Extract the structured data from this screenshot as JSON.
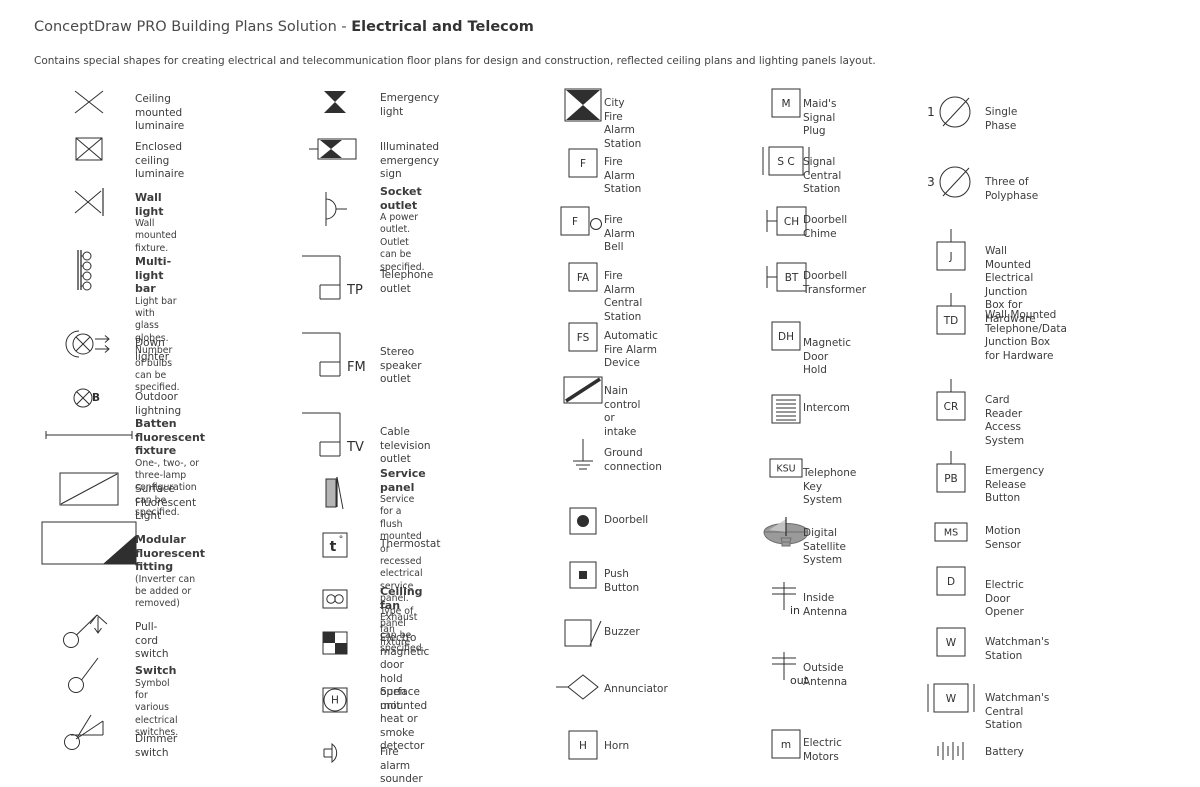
{
  "header": {
    "title_normal": "ConceptDraw PRO Building Plans Solution - ",
    "title_bold": "Electrical and Telecom",
    "subtitle": "Contains special shapes for creating electrical and telecommunication floor plans for design and construction, reflected ceiling plans and lighting panels layout."
  },
  "colors": {
    "ink": "#2f2f2f",
    "text": "#3c3c3c",
    "satellite_body": "#9a9a9a",
    "satellite_light": "#c9c9c9",
    "panel_fill": "#b5b5b5"
  },
  "columns": [
    {
      "id": "col-1",
      "items": [
        {
          "id": "ceiling-mounted-luminaire",
          "icon": "x-cross",
          "title": "Ceiling mounted luminaire",
          "desc": []
        },
        {
          "id": "enclosed-ceiling-luminaire",
          "icon": "boxed-x",
          "title": "Enclosed ceiling luminaire",
          "desc": []
        },
        {
          "id": "wall-light",
          "icon": "wall-x",
          "title": "Wall light",
          "desc": [
            "Wall mounted fixture."
          ]
        },
        {
          "id": "multi-light-bar",
          "icon": "multi-light-bar",
          "title": "Multi-light bar",
          "desc": [
            "Light bar with glass globes.",
            "Number of bulbs can be specified."
          ]
        },
        {
          "id": "down-lighter",
          "icon": "down-lighter",
          "title": "Down lighter",
          "desc": []
        },
        {
          "id": "outdoor-lightning",
          "icon": "circle-x-b",
          "badge": "B",
          "title": "Outdoor lightning",
          "desc": []
        },
        {
          "id": "batten-fluorescent-fixture",
          "icon": "batten-bar",
          "title": "Batten fluorescent fixture",
          "desc": [
            "One-, two-, or three-lamp",
            "configuration can be specified."
          ]
        },
        {
          "id": "surface-fluorescent-light",
          "icon": "rect-diag",
          "title": "Surface Fluorescent Light",
          "desc": []
        },
        {
          "id": "modular-fluorescent-fitting",
          "icon": "rect-inverter",
          "title": "Modular fluorescent fitting",
          "desc": [
            "(Inverter can be added or",
            "removed)"
          ]
        },
        {
          "id": "pull-cord-switch",
          "icon": "pull-cord-switch",
          "title": "Pull-cord switch",
          "desc": []
        },
        {
          "id": "switch",
          "icon": "switch",
          "title": "Switch",
          "desc": [
            "Symbol for various electrical",
            "switches."
          ]
        },
        {
          "id": "dimmer-switch",
          "icon": "dimmer-switch",
          "title": "Dimmer switch",
          "desc": []
        }
      ]
    },
    {
      "id": "col-2",
      "items": [
        {
          "id": "emergency-light",
          "icon": "bowtie",
          "title": "Emergency light",
          "desc": []
        },
        {
          "id": "illuminated-emergency-sign",
          "icon": "bowtie-sign",
          "title": "Illuminated emergency sign",
          "desc": []
        },
        {
          "id": "socket-outlet",
          "icon": "socket-outlet",
          "title": "Socket outlet",
          "desc": [
            "A power outlet. Outlet can be",
            "specified."
          ]
        },
        {
          "id": "telephone-outlet",
          "icon": "outlet-drop",
          "badge": "TP",
          "title": "Telephone outlet",
          "desc": []
        },
        {
          "id": "stereo-speaker-outlet",
          "icon": "outlet-drop",
          "badge": "FM",
          "title": "Stereo speaker outlet",
          "desc": []
        },
        {
          "id": "cable-television-outlet",
          "icon": "outlet-drop",
          "badge": "TV",
          "title": "Cable television outlet",
          "desc": []
        },
        {
          "id": "service-panel",
          "icon": "service-panel",
          "title": "Service panel",
          "desc": [
            "Service for a flush mounted or recessed",
            " electrical service panel. Type of panel",
            "can be specified."
          ]
        },
        {
          "id": "thermostat",
          "icon": "thermostat",
          "badge": "t°",
          "title": "Thermostat",
          "desc": []
        },
        {
          "id": "ceiling-fan",
          "icon": "ceiling-fan",
          "title": "Ceiling fan",
          "desc": [
            "Exhaust fan fixture"
          ]
        },
        {
          "id": "electro-magnetic-door-hold",
          "icon": "checker",
          "title": "Electro magnetic door hold open",
          "desc": [
            "unit"
          ],
          "title_two_line": true
        },
        {
          "id": "heat-smoke-detector",
          "icon": "boxed-circle-h",
          "badge": "H",
          "title": "Surface mounted heat or smoke",
          "desc": [
            "detector"
          ],
          "title_two_line": true
        },
        {
          "id": "fire-alarm-sounder",
          "icon": "fire-alarm-sounder",
          "title": "Fire alarm sounder",
          "desc": []
        }
      ]
    },
    {
      "id": "col-3",
      "items": [
        {
          "id": "city-fire-alarm-station",
          "icon": "boxed-bowtie-filled",
          "title": "City Fire Alarm Station",
          "desc": []
        },
        {
          "id": "fire-alarm-station",
          "icon": "box-label",
          "badge": "F",
          "title": "Fire Alarm Station",
          "desc": []
        },
        {
          "id": "fire-alarm-bell",
          "icon": "box-label-bell",
          "badge": "F",
          "title": "Fire Alarm Bell",
          "desc": []
        },
        {
          "id": "fire-alarm-central-station",
          "icon": "box-label",
          "badge": "FA",
          "title": "Fire Alarm Central Station",
          "desc": []
        },
        {
          "id": "automatic-fire-alarm-device",
          "icon": "box-label",
          "badge": "FS",
          "title": "Automatic Fire Alarm Device",
          "desc": []
        },
        {
          "id": "main-control-or-intake",
          "icon": "rect-thick-diag",
          "title": "Nain control or intake",
          "desc": []
        },
        {
          "id": "ground-connection",
          "icon": "ground",
          "title": "Ground connection",
          "desc": []
        },
        {
          "id": "doorbell",
          "icon": "box-dot-round",
          "title": "Doorbell",
          "desc": []
        },
        {
          "id": "push-button",
          "icon": "box-dot-square",
          "title": "Push Button",
          "desc": []
        },
        {
          "id": "buzzer",
          "icon": "buzzer",
          "title": "Buzzer",
          "desc": []
        },
        {
          "id": "annunciator",
          "icon": "annunciator",
          "title": "Annunciator",
          "desc": []
        },
        {
          "id": "horn",
          "icon": "box-label",
          "badge": "H",
          "title": "Horn",
          "desc": []
        }
      ]
    },
    {
      "id": "col-4",
      "items": [
        {
          "id": "maids-signal-plug",
          "icon": "box-label",
          "badge": "M",
          "title": "Maid's Signal Plug",
          "desc": []
        },
        {
          "id": "signal-central-station",
          "icon": "box-label-flanked",
          "badge": "S C",
          "title": "Signal Central Station",
          "desc": []
        },
        {
          "id": "doorbell-chime",
          "icon": "box-label-lead",
          "badge": "CH",
          "title": "Doorbell Chime",
          "desc": []
        },
        {
          "id": "doorbell-transformer",
          "icon": "box-label-lead",
          "badge": "BT",
          "title": "Doorbell Transformer",
          "desc": []
        },
        {
          "id": "magnetic-door-hold",
          "icon": "box-label",
          "badge": "DH",
          "title": "Magnetic Door Hold",
          "desc": []
        },
        {
          "id": "intercom",
          "icon": "intercom",
          "title": "Intercom",
          "desc": []
        },
        {
          "id": "telephone-key-system",
          "icon": "box-label-small",
          "badge": "KSU",
          "title": "Telephone Key System",
          "desc": []
        },
        {
          "id": "digital-satellite-system",
          "icon": "satellite",
          "title": "Digital Satellite System",
          "desc": []
        },
        {
          "id": "inside-antenna",
          "icon": "antenna",
          "badge": "in",
          "title": "Inside Antenna",
          "desc": []
        },
        {
          "id": "outside-antenna",
          "icon": "antenna",
          "badge": "out",
          "title": "Outside Antenna",
          "desc": []
        },
        {
          "id": "electric-motors",
          "icon": "box-label",
          "badge": "m",
          "title": "Electric Motors",
          "desc": []
        }
      ]
    },
    {
      "id": "col-5",
      "items": [
        {
          "id": "single-phase",
          "icon": "phase-circle",
          "badge": "1",
          "title": "Single Phase",
          "desc": []
        },
        {
          "id": "three-of-polyphase",
          "icon": "phase-circle",
          "badge": "3",
          "title": "Three of Polyphase",
          "desc": []
        },
        {
          "id": "wall-mounted-electrical-junction-box",
          "icon": "box-label-stem",
          "badge": "J",
          "title": "Wall Mounted Electrical",
          "desc": [
            "Junction Box for Hardware"
          ],
          "title_two_line": true
        },
        {
          "id": "wall-mounted-telephone-data-junction-box",
          "icon": "box-label-stem",
          "badge": "TD",
          "title": "Wall Mounted",
          "desc": [
            "Telephone/Data Junction Box",
            " for Hardware"
          ],
          "title_two_line": true
        },
        {
          "id": "card-reader-access-system",
          "icon": "box-label-stem",
          "badge": "CR",
          "title": "Card Reader Access System",
          "desc": []
        },
        {
          "id": "emergency-release-button",
          "icon": "box-label-stem",
          "badge": "PB",
          "title": "Emergency Release Button",
          "desc": []
        },
        {
          "id": "motion-sensor",
          "icon": "box-label-small",
          "badge": "MS",
          "title": "Motion Sensor",
          "desc": []
        },
        {
          "id": "electric-door-opener",
          "icon": "box-label",
          "badge": "D",
          "title": "Electric Door Opener",
          "desc": []
        },
        {
          "id": "watchmans-station",
          "icon": "box-label",
          "badge": "W",
          "title": "Watchman's Station",
          "desc": []
        },
        {
          "id": "watchmans-central-station",
          "icon": "box-label-flanked",
          "badge": "W",
          "title": "Watchman's Central Station",
          "desc": []
        },
        {
          "id": "battery",
          "icon": "battery",
          "title": "Battery",
          "desc": []
        }
      ]
    }
  ]
}
